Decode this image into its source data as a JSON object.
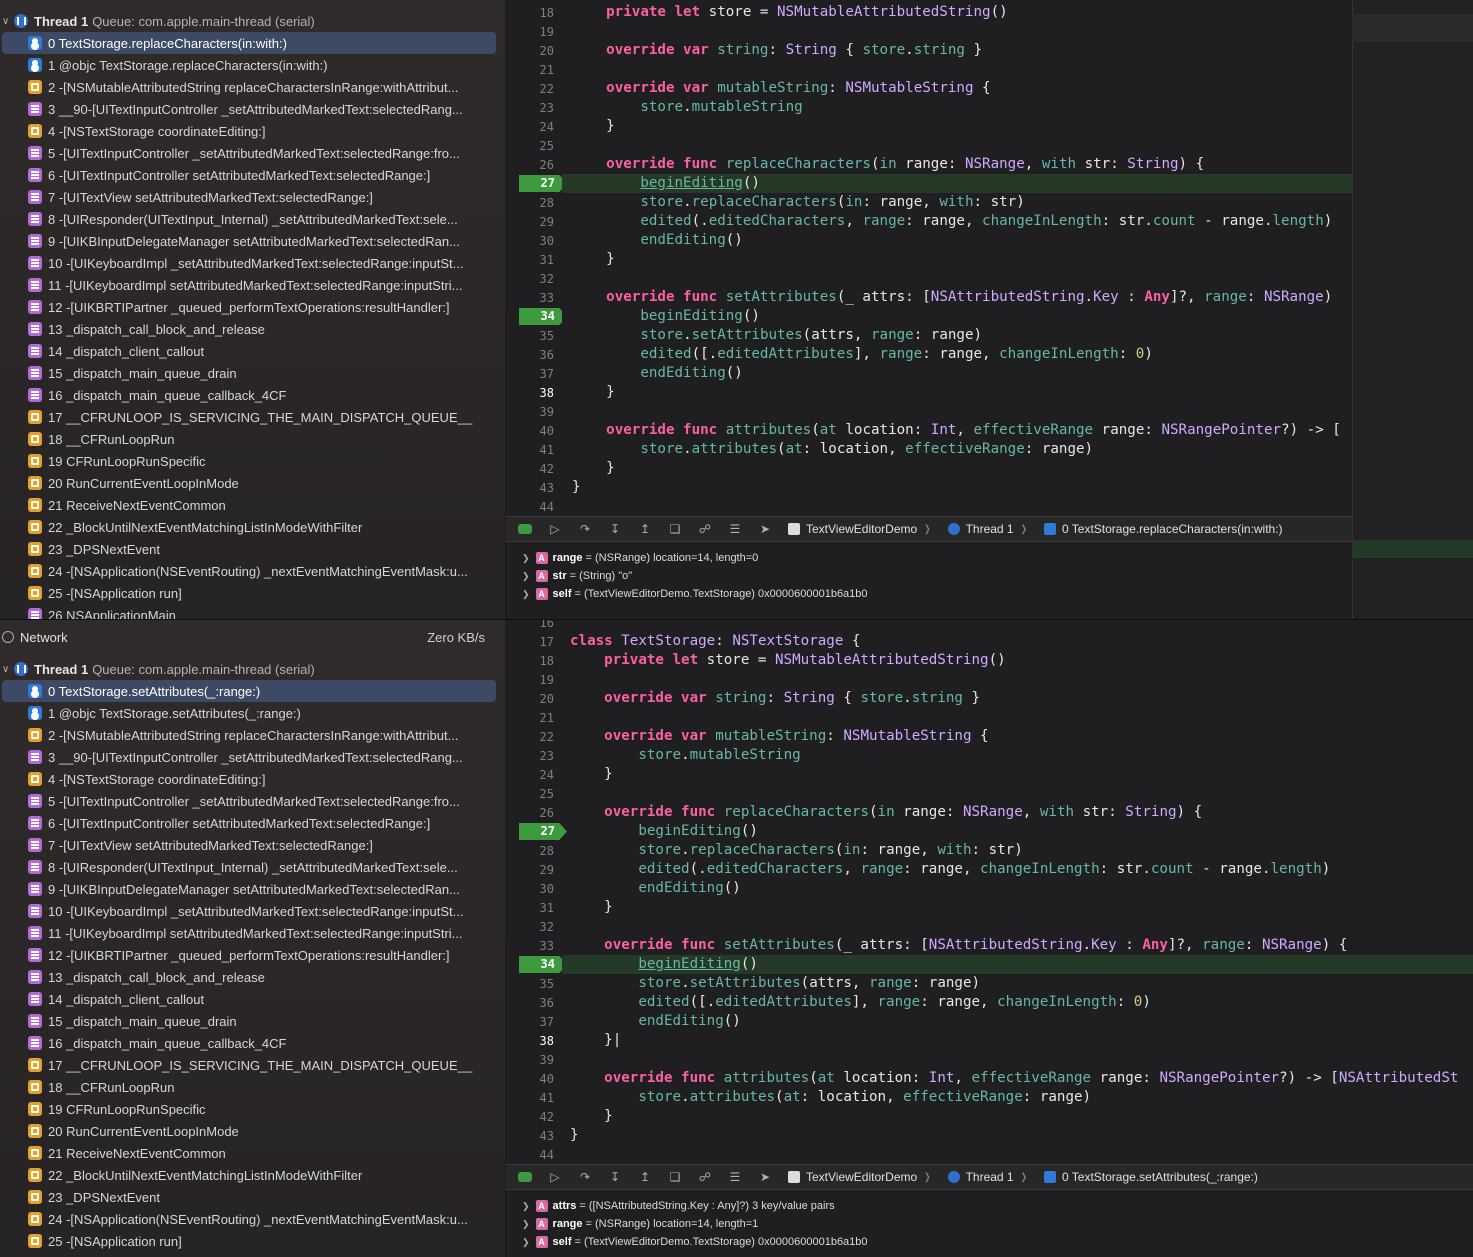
{
  "top": {
    "thread": {
      "name": "Thread 1",
      "queue": "Queue: com.apple.main-thread (serial)"
    },
    "frames": [
      {
        "label": "0 TextStorage.replaceCharacters(in:with:)",
        "icon": "user"
      },
      {
        "label": "1 @objc TextStorage.replaceCharacters(in:with:)",
        "icon": "user"
      },
      {
        "label": "2 -[NSMutableAttributedString replaceCharactersInRange:withAttribut...",
        "icon": "fw"
      },
      {
        "label": "3 __90-[UITextInputController _setAttributedMarkedText:selectedRang...",
        "icon": "lib"
      },
      {
        "label": "4 -[NSTextStorage coordinateEditing:]",
        "icon": "fw"
      },
      {
        "label": "5 -[UITextInputController _setAttributedMarkedText:selectedRange:fro...",
        "icon": "lib"
      },
      {
        "label": "6 -[UITextInputController setAttributedMarkedText:selectedRange:]",
        "icon": "lib"
      },
      {
        "label": "7 -[UITextView setAttributedMarkedText:selectedRange:]",
        "icon": "lib"
      },
      {
        "label": "8 -[UIResponder(UITextInput_Internal) _setAttributedMarkedText:sele...",
        "icon": "lib"
      },
      {
        "label": "9 -[UIKBInputDelegateManager setAttributedMarkedText:selectedRan...",
        "icon": "lib"
      },
      {
        "label": "10 -[UIKeyboardImpl _setAttributedMarkedText:selectedRange:inputSt...",
        "icon": "lib"
      },
      {
        "label": "11 -[UIKeyboardImpl setAttributedMarkedText:selectedRange:inputStri...",
        "icon": "lib"
      },
      {
        "label": "12 -[UIKBRTIPartner _queued_performTextOperations:resultHandler:]",
        "icon": "lib"
      },
      {
        "label": "13 _dispatch_call_block_and_release",
        "icon": "lib"
      },
      {
        "label": "14 _dispatch_client_callout",
        "icon": "lib"
      },
      {
        "label": "15 _dispatch_main_queue_drain",
        "icon": "lib"
      },
      {
        "label": "16 _dispatch_main_queue_callback_4CF",
        "icon": "lib"
      },
      {
        "label": "17 __CFRUNLOOP_IS_SERVICING_THE_MAIN_DISPATCH_QUEUE__",
        "icon": "fw"
      },
      {
        "label": "18 __CFRunLoopRun",
        "icon": "fw"
      },
      {
        "label": "19 CFRunLoopRunSpecific",
        "icon": "fw"
      },
      {
        "label": "20 RunCurrentEventLoopInMode",
        "icon": "fw"
      },
      {
        "label": "21 ReceiveNextEventCommon",
        "icon": "fw"
      },
      {
        "label": "22 _BlockUntilNextEventMatchingListInModeWithFilter",
        "icon": "fw"
      },
      {
        "label": "23 _DPSNextEvent",
        "icon": "fw"
      },
      {
        "label": "24 -[NSApplication(NSEventRouting) _nextEventMatchingEventMask:u...",
        "icon": "fw"
      },
      {
        "label": "25 -[NSApplication run]",
        "icon": "fw"
      },
      {
        "label": "26 NSApplicationMain",
        "icon": "lib"
      }
    ],
    "breadcrumb": [
      "TextViewEditorDemo",
      "Thread 1",
      "0 TextStorage.replaceCharacters(in:with:)"
    ],
    "vars": [
      {
        "name": "range",
        "value": "= (NSRange) location=14, length=0"
      },
      {
        "name": "str",
        "value": "= (String) \"o\""
      },
      {
        "name": "self",
        "value": "= (TextViewEditorDemo.TextStorage) 0x0000600001b6a1b0"
      }
    ]
  },
  "bottom": {
    "network": {
      "label": "Network",
      "value": "Zero KB/s"
    },
    "thread": {
      "name": "Thread 1",
      "queue": "Queue: com.apple.main-thread (serial)"
    },
    "frames": [
      {
        "label": "0 TextStorage.setAttributes(_:range:)",
        "icon": "user"
      },
      {
        "label": "1 @objc TextStorage.setAttributes(_:range:)",
        "icon": "user"
      },
      {
        "label": "2 -[NSMutableAttributedString replaceCharactersInRange:withAttribut...",
        "icon": "fw"
      },
      {
        "label": "3 __90-[UITextInputController _setAttributedMarkedText:selectedRang...",
        "icon": "lib"
      },
      {
        "label": "4 -[NSTextStorage coordinateEditing:]",
        "icon": "fw"
      },
      {
        "label": "5 -[UITextInputController _setAttributedMarkedText:selectedRange:fro...",
        "icon": "lib"
      },
      {
        "label": "6 -[UITextInputController setAttributedMarkedText:selectedRange:]",
        "icon": "lib"
      },
      {
        "label": "7 -[UITextView setAttributedMarkedText:selectedRange:]",
        "icon": "lib"
      },
      {
        "label": "8 -[UIResponder(UITextInput_Internal) _setAttributedMarkedText:sele...",
        "icon": "lib"
      },
      {
        "label": "9 -[UIKBInputDelegateManager setAttributedMarkedText:selectedRan...",
        "icon": "lib"
      },
      {
        "label": "10 -[UIKeyboardImpl _setAttributedMarkedText:selectedRange:inputSt...",
        "icon": "lib"
      },
      {
        "label": "11 -[UIKeyboardImpl setAttributedMarkedText:selectedRange:inputStri...",
        "icon": "lib"
      },
      {
        "label": "12 -[UIKBRTIPartner _queued_performTextOperations:resultHandler:]",
        "icon": "lib"
      },
      {
        "label": "13 _dispatch_call_block_and_release",
        "icon": "lib"
      },
      {
        "label": "14 _dispatch_client_callout",
        "icon": "lib"
      },
      {
        "label": "15 _dispatch_main_queue_drain",
        "icon": "lib"
      },
      {
        "label": "16 _dispatch_main_queue_callback_4CF",
        "icon": "lib"
      },
      {
        "label": "17 __CFRUNLOOP_IS_SERVICING_THE_MAIN_DISPATCH_QUEUE__",
        "icon": "fw"
      },
      {
        "label": "18 __CFRunLoopRun",
        "icon": "fw"
      },
      {
        "label": "19 CFRunLoopRunSpecific",
        "icon": "fw"
      },
      {
        "label": "20 RunCurrentEventLoopInMode",
        "icon": "fw"
      },
      {
        "label": "21 ReceiveNextEventCommon",
        "icon": "fw"
      },
      {
        "label": "22 _BlockUntilNextEventMatchingListInModeWithFilter",
        "icon": "fw"
      },
      {
        "label": "23 _DPSNextEvent",
        "icon": "fw"
      },
      {
        "label": "24 -[NSApplication(NSEventRouting) _nextEventMatchingEventMask:u...",
        "icon": "fw"
      },
      {
        "label": "25 -[NSApplication run]",
        "icon": "fw"
      }
    ],
    "breadcrumb": [
      "TextViewEditorDemo",
      "Thread 1",
      "0 TextStorage.setAttributes(_:range:)"
    ],
    "vars": [
      {
        "name": "attrs",
        "value": "= ([NSAttributedString.Key : Any]?) 3 key/value pairs"
      },
      {
        "name": "range",
        "value": "= (NSRange) location=14, length=1"
      },
      {
        "name": "self",
        "value": "= (TextViewEditorDemo.TextStorage) 0x0000600001b6a1b0"
      }
    ]
  },
  "code": {
    "top_lines": [
      "18",
      "19",
      "20",
      "21",
      "22",
      "23",
      "24",
      "25",
      "26",
      "27",
      "28",
      "29",
      "30",
      "31",
      "32",
      "33",
      "34",
      "35",
      "36",
      "37",
      "38",
      "39",
      "40",
      "41",
      "42",
      "43",
      "44"
    ],
    "bottom_lines": [
      "16",
      "17",
      "18",
      "19",
      "20",
      "21",
      "22",
      "23",
      "24",
      "25",
      "26",
      "27",
      "28",
      "29",
      "30",
      "31",
      "32",
      "33",
      "34",
      "35",
      "36",
      "37",
      "38",
      "39",
      "40",
      "41",
      "42",
      "43",
      "44"
    ],
    "breakpoints": [
      "27",
      "34"
    ],
    "current_line": "38"
  },
  "colors": {
    "breakpoint": "#3e9a3e",
    "keyword": "#fc5fa3",
    "function": "#67b7a4",
    "type": "#d0a8ff",
    "selection": "#3c4a66"
  }
}
